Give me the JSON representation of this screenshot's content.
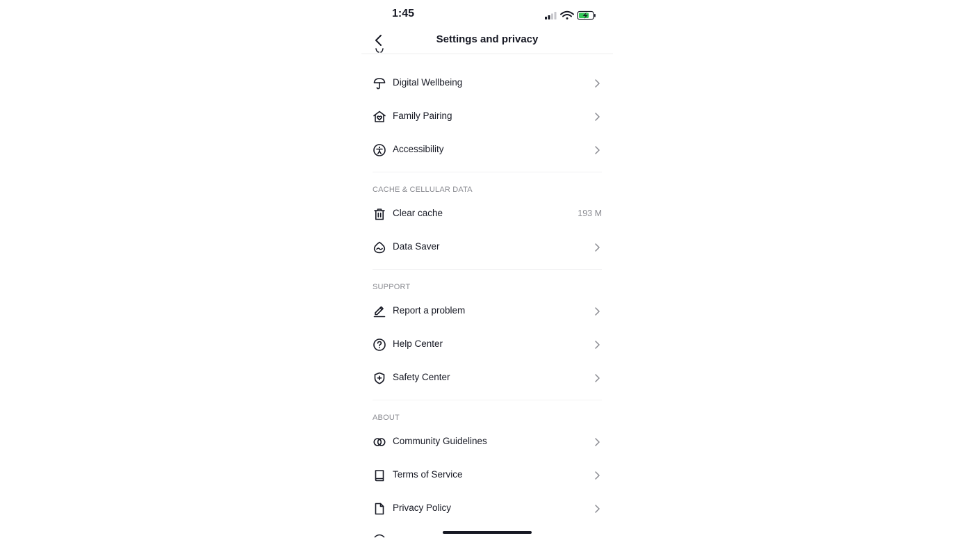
{
  "status_bar": {
    "time": "1:45"
  },
  "nav": {
    "title": "Settings and privacy",
    "back_icon": "chevron-left-icon"
  },
  "sections": [
    {
      "items": [
        {
          "label": "Digital Wellbeing",
          "icon": "umbrella-icon",
          "trailing": "chevron"
        },
        {
          "label": "Family Pairing",
          "icon": "family-house-icon",
          "trailing": "chevron"
        },
        {
          "label": "Accessibility",
          "icon": "accessibility-icon",
          "trailing": "chevron"
        }
      ]
    },
    {
      "header": "CACHE & CELLULAR DATA",
      "items": [
        {
          "label": "Clear cache",
          "icon": "trash-icon",
          "trailing": "value",
          "value": "193 M"
        },
        {
          "label": "Data Saver",
          "icon": "data-saver-icon",
          "trailing": "chevron"
        }
      ]
    },
    {
      "header": "SUPPORT",
      "items": [
        {
          "label": "Report a problem",
          "icon": "pencil-icon",
          "trailing": "chevron"
        },
        {
          "label": "Help Center",
          "icon": "question-circle-icon",
          "trailing": "chevron"
        },
        {
          "label": "Safety Center",
          "icon": "shield-plus-icon",
          "trailing": "chevron"
        }
      ]
    },
    {
      "header": "ABOUT",
      "items": [
        {
          "label": "Community Guidelines",
          "icon": "rings-icon",
          "trailing": "chevron"
        },
        {
          "label": "Terms of Service",
          "icon": "book-icon",
          "trailing": "chevron"
        },
        {
          "label": "Privacy Policy",
          "icon": "document-icon",
          "trailing": "chevron"
        }
      ]
    }
  ],
  "colors": {
    "text": "#161823",
    "secondary": "#8a8b91",
    "divider": "#f1f1f2",
    "battery_charge": "#34c759"
  }
}
